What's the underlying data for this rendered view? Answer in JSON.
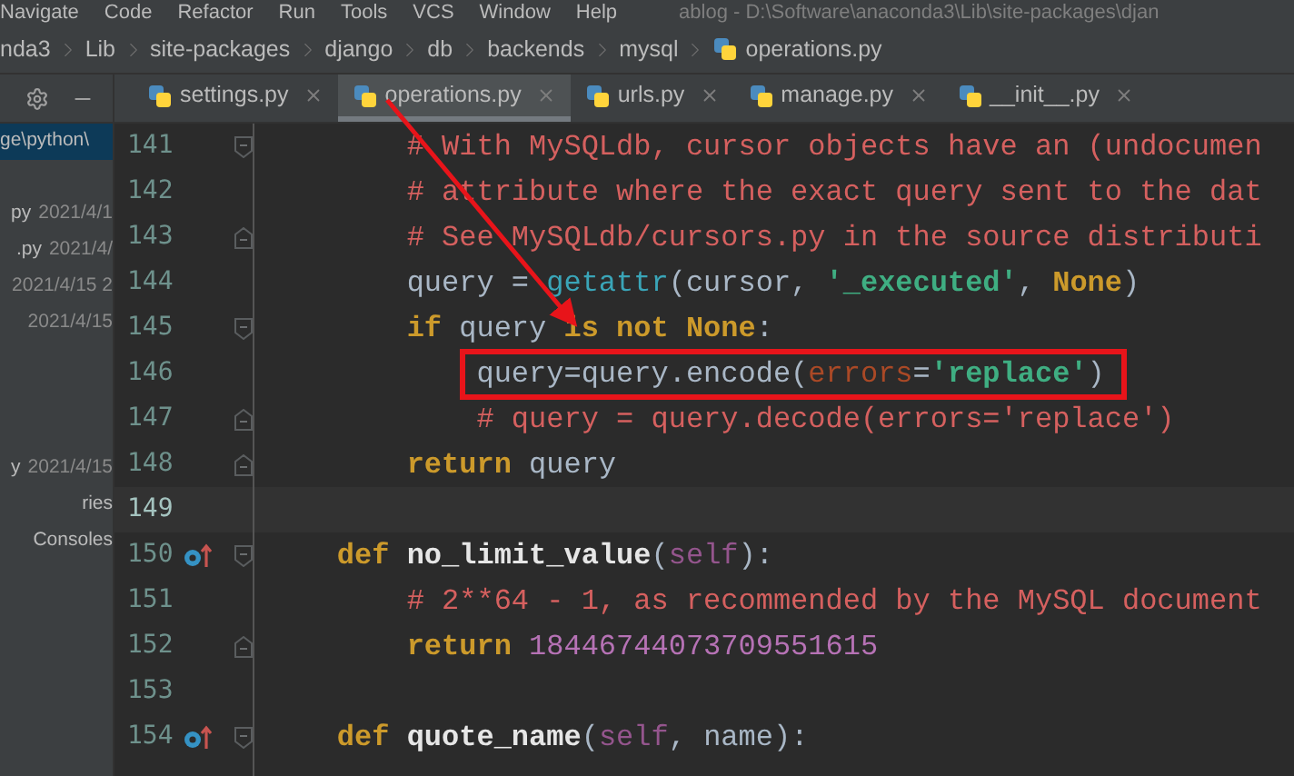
{
  "menu": [
    "Navigate",
    "Code",
    "Refactor",
    "Run",
    "Tools",
    "VCS",
    "Window",
    "Help"
  ],
  "window": {
    "title": "ablog - D:\\Software\\anaconda3\\Lib\\site-packages\\djan"
  },
  "breadcrumb": [
    {
      "label": "nda3",
      "file": false
    },
    {
      "label": "Lib",
      "file": false
    },
    {
      "label": "site-packages",
      "file": false
    },
    {
      "label": "django",
      "file": false
    },
    {
      "label": "db",
      "file": false
    },
    {
      "label": "backends",
      "file": false
    },
    {
      "label": "mysql",
      "file": false
    },
    {
      "label": "operations.py",
      "file": true
    }
  ],
  "tabs": [
    {
      "label": "settings.py",
      "selected": false
    },
    {
      "label": "operations.py",
      "selected": true
    },
    {
      "label": "urls.py",
      "selected": false
    },
    {
      "label": "manage.py",
      "selected": false
    },
    {
      "label": "__init__.py",
      "selected": false
    }
  ],
  "project_tree": [
    [
      {
        "name": "ge\\python\\",
        "selected": true
      }
    ],
    [
      {
        "name": "py",
        "date": "2021/4/1",
        "selected": false
      },
      {
        "name": ".py",
        "date": "2021/4/",
        "selected": false
      },
      {
        "date": "2021/4/15 2",
        "selected": false
      },
      {
        "date": "2021/4/15",
        "selected": false
      }
    ],
    [
      {
        "name": "y",
        "date": "2021/4/15",
        "selected": false
      },
      {
        "name": "ries",
        "selected": false
      },
      {
        "name": "Consoles",
        "selected": false
      }
    ]
  ],
  "lines": [
    {
      "number": "141",
      "current": false,
      "override": false,
      "fold_start": true,
      "fold_end": false,
      "highlighted": false,
      "tokens": [
        {
          "kind": "comment",
          "text": "        # With MySQLdb, cursor objects have an (undocumen"
        }
      ]
    },
    {
      "number": "142",
      "current": false,
      "override": false,
      "fold_start": false,
      "fold_end": false,
      "highlighted": false,
      "tokens": [
        {
          "kind": "comment",
          "text": "        # attribute where the exact query sent to the dat"
        }
      ]
    },
    {
      "number": "143",
      "current": false,
      "override": false,
      "fold_start": false,
      "fold_end": true,
      "highlighted": false,
      "tokens": [
        {
          "kind": "comment",
          "text": "        # See MySQLdb/cursors.py in the source distributi"
        }
      ]
    },
    {
      "number": "144",
      "current": false,
      "override": false,
      "fold_start": false,
      "fold_end": false,
      "highlighted": false,
      "tokens": [
        {
          "kind": "plain",
          "text": "        query = "
        },
        {
          "kind": "builtin",
          "text": "getattr"
        },
        {
          "kind": "plain",
          "text": "(cursor, "
        },
        {
          "kind": "string",
          "text": "'_executed'"
        },
        {
          "kind": "plain",
          "text": ", "
        },
        {
          "kind": "keyword",
          "text": "None"
        },
        {
          "kind": "plain",
          "text": ")"
        }
      ]
    },
    {
      "number": "145",
      "current": false,
      "override": false,
      "fold_start": true,
      "fold_end": false,
      "highlighted": false,
      "tokens": [
        {
          "kind": "keyword",
          "text": "        if"
        },
        {
          "kind": "plain",
          "text": " query "
        },
        {
          "kind": "keyword",
          "text": "is not None"
        },
        {
          "kind": "plain",
          "text": ":"
        }
      ]
    },
    {
      "number": "146",
      "current": false,
      "override": false,
      "fold_start": false,
      "fold_end": false,
      "highlighted": true,
      "tokens": [
        {
          "kind": "plain",
          "text": "            query=query.encode("
        },
        {
          "kind": "param",
          "text": "errors"
        },
        {
          "kind": "plain",
          "text": "="
        },
        {
          "kind": "string",
          "text": "'replace'"
        },
        {
          "kind": "plain",
          "text": ")"
        }
      ]
    },
    {
      "number": "147",
      "current": false,
      "override": false,
      "fold_start": false,
      "fold_end": true,
      "highlighted": false,
      "tokens": [
        {
          "kind": "comment",
          "text": "            # query = query.decode(errors='replace')"
        }
      ]
    },
    {
      "number": "148",
      "current": false,
      "override": false,
      "fold_start": false,
      "fold_end": true,
      "highlighted": false,
      "tokens": [
        {
          "kind": "keyword",
          "text": "        return"
        },
        {
          "kind": "plain",
          "text": " query"
        }
      ]
    },
    {
      "number": "149",
      "current": true,
      "override": false,
      "fold_start": false,
      "fold_end": false,
      "highlighted": false
    },
    {
      "number": "150",
      "current": false,
      "override": true,
      "fold_start": true,
      "fold_end": false,
      "highlighted": false,
      "tokens": [
        {
          "kind": "keyword",
          "text": "    def"
        },
        {
          "kind": "func",
          "text": " no_limit_value"
        },
        {
          "kind": "plain",
          "text": "("
        },
        {
          "kind": "self",
          "text": "self"
        },
        {
          "kind": "plain",
          "text": "):"
        }
      ]
    },
    {
      "number": "151",
      "current": false,
      "override": false,
      "fold_start": false,
      "fold_end": false,
      "highlighted": false,
      "tokens": [
        {
          "kind": "comment",
          "text": "        # 2**64 - 1, as recommended by the MySQL document"
        }
      ]
    },
    {
      "number": "152",
      "current": false,
      "override": false,
      "fold_start": false,
      "fold_end": true,
      "highlighted": false,
      "tokens": [
        {
          "kind": "keyword",
          "text": "        return"
        },
        {
          "kind": "number",
          "text": " 18446744073709551615"
        }
      ]
    },
    {
      "number": "153",
      "current": false,
      "override": false,
      "fold_start": false,
      "fold_end": false,
      "highlighted": false
    },
    {
      "number": "154",
      "current": false,
      "override": true,
      "fold_start": true,
      "fold_end": false,
      "highlighted": false,
      "tokens": [
        {
          "kind": "keyword",
          "text": "    def"
        },
        {
          "kind": "func",
          "text": " quote_name"
        },
        {
          "kind": "plain",
          "text": "("
        },
        {
          "kind": "self",
          "text": "self"
        },
        {
          "kind": "plain",
          "text": ", name):"
        }
      ]
    }
  ]
}
